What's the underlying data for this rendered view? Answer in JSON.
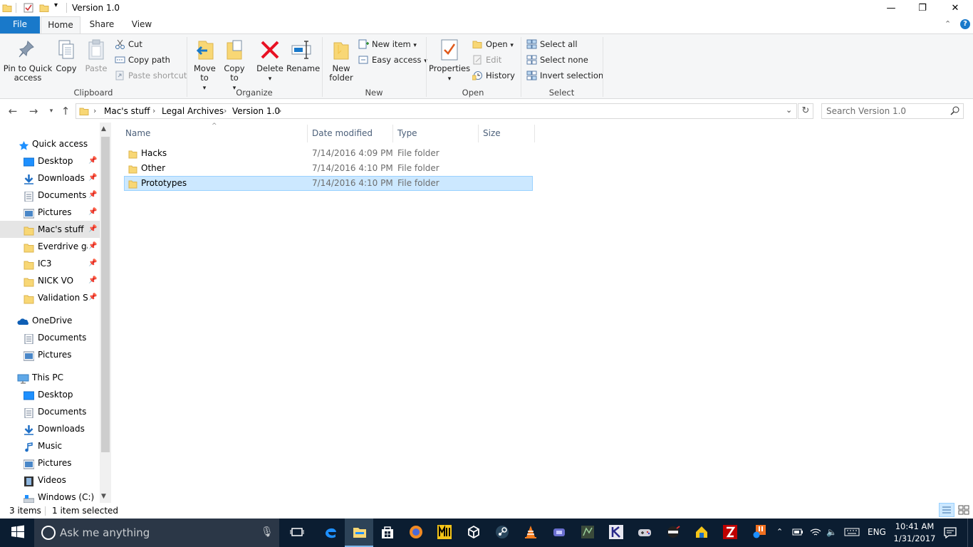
{
  "window": {
    "title": "Version 1.0",
    "controls": {
      "minimize": "—",
      "maximize": "❐",
      "close": "✕"
    }
  },
  "ribbon": {
    "tabs": [
      {
        "label": "File"
      },
      {
        "label": "Home"
      },
      {
        "label": "Share"
      },
      {
        "label": "View"
      }
    ],
    "clipboard": {
      "group_label": "Clipboard",
      "pin_label": "Pin to Quick access",
      "copy_label": "Copy",
      "paste_label": "Paste",
      "cut_label": "Cut",
      "copy_path_label": "Copy path",
      "paste_shortcut_label": "Paste shortcut"
    },
    "organize": {
      "group_label": "Organize",
      "move_to_label": "Move to",
      "copy_to_label": "Copy to",
      "delete_label": "Delete",
      "rename_label": "Rename"
    },
    "new": {
      "group_label": "New",
      "new_folder_label": "New folder",
      "new_item_label": "New item",
      "easy_access_label": "Easy access"
    },
    "open": {
      "group_label": "Open",
      "properties_label": "Properties",
      "open_label": "Open",
      "edit_label": "Edit",
      "history_label": "History"
    },
    "select": {
      "group_label": "Select",
      "select_all_label": "Select all",
      "select_none_label": "Select none",
      "invert_selection_label": "Invert selection"
    }
  },
  "address": {
    "breadcrumbs": [
      "Mac's stuff",
      "Legal Archives",
      "Version 1.0"
    ],
    "search_placeholder": "Search Version 1.0"
  },
  "nav_pane": {
    "quick_access_label": "Quick access",
    "quick_access_items": [
      {
        "label": "Desktop",
        "icon": "desktop-icon"
      },
      {
        "label": "Downloads",
        "icon": "downloads-icon"
      },
      {
        "label": "Documents",
        "icon": "documents-icon"
      },
      {
        "label": "Pictures",
        "icon": "pictures-icon"
      },
      {
        "label": "Mac's stuff",
        "icon": "folder-icon"
      },
      {
        "label": "Everdrive gan",
        "icon": "folder-icon"
      },
      {
        "label": "IC3",
        "icon": "folder-icon"
      },
      {
        "label": "NICK VO",
        "icon": "folder-icon"
      },
      {
        "label": "Validation Scr",
        "icon": "folder-icon"
      }
    ],
    "onedrive_label": "OneDrive",
    "onedrive_items": [
      {
        "label": "Documents"
      },
      {
        "label": "Pictures"
      }
    ],
    "this_pc_label": "This PC",
    "this_pc_items": [
      {
        "label": "Desktop"
      },
      {
        "label": "Documents"
      },
      {
        "label": "Downloads"
      },
      {
        "label": "Music"
      },
      {
        "label": "Pictures"
      },
      {
        "label": "Videos"
      },
      {
        "label": "Windows (C:)"
      }
    ]
  },
  "file_list": {
    "columns": [
      "Name",
      "Date modified",
      "Type",
      "Size"
    ],
    "rows": [
      {
        "name": "Hacks",
        "date": "7/14/2016 4:09 PM",
        "type": "File folder",
        "size": ""
      },
      {
        "name": "Other",
        "date": "7/14/2016 4:10 PM",
        "type": "File folder",
        "size": ""
      },
      {
        "name": "Prototypes",
        "date": "7/14/2016 4:10 PM",
        "type": "File folder",
        "size": ""
      }
    ]
  },
  "status": {
    "item_count": "3 items",
    "selection": "1 item selected"
  },
  "taskbar": {
    "search_placeholder": "Ask me anything",
    "language": "ENG",
    "time": "10:41 AM",
    "date": "1/31/2017"
  },
  "colors": {
    "file_tab": "#1979ca",
    "selection_bg": "#cce8ff",
    "selection_border": "#99d1ff",
    "taskbar": "#0b1d31",
    "folder": "#f8d775"
  }
}
